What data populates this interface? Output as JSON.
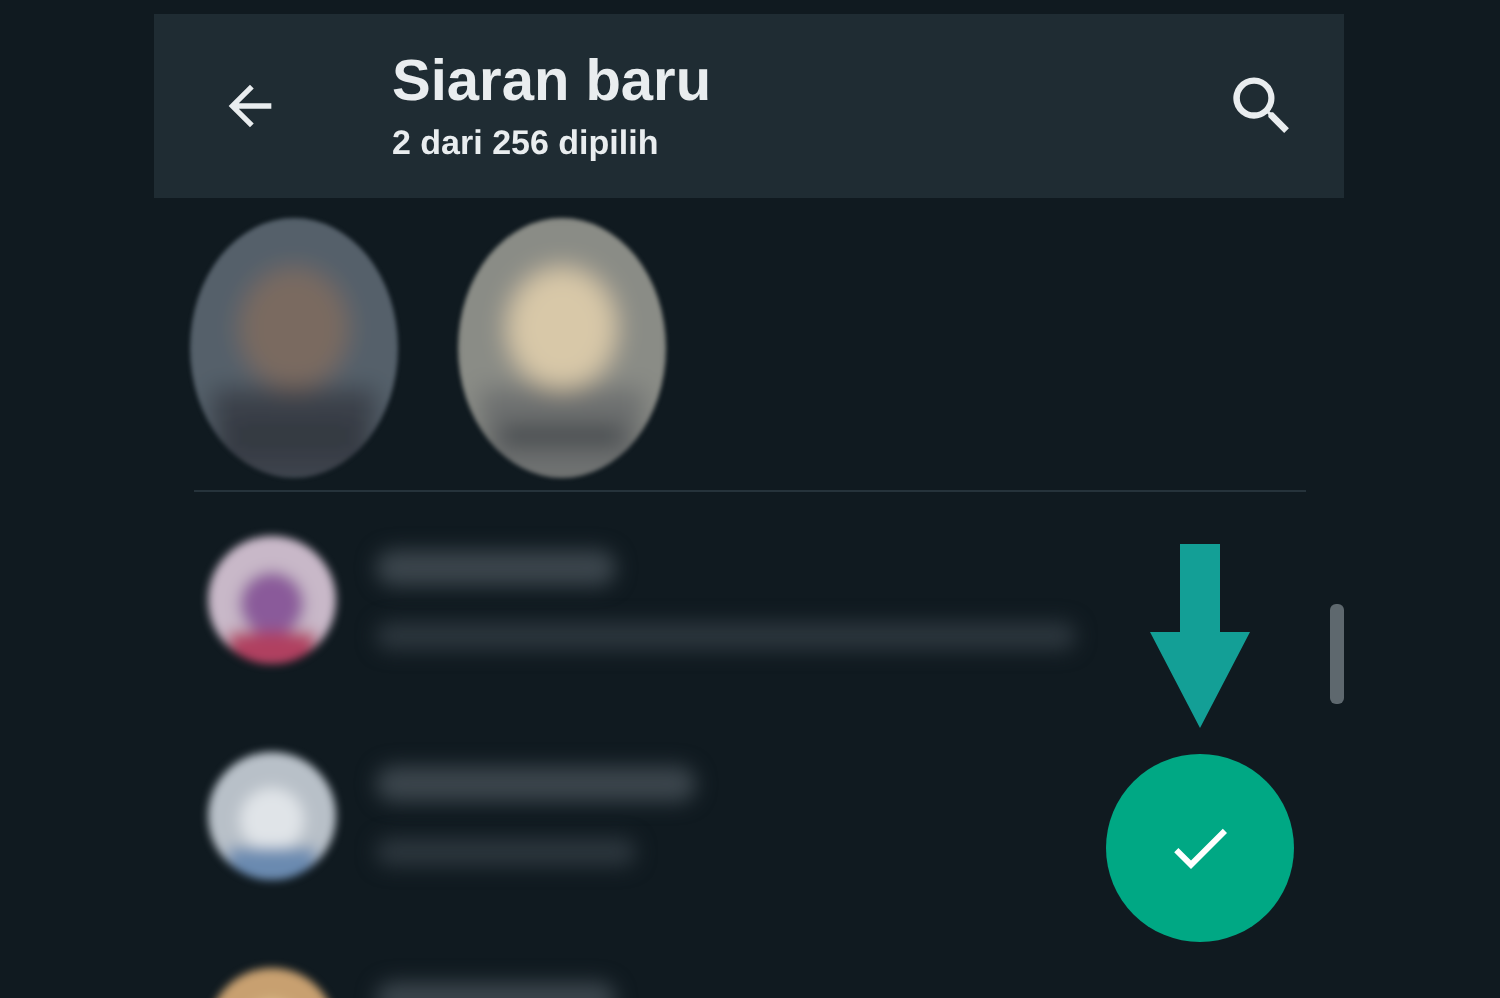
{
  "header": {
    "title": "Siaran baru",
    "subtitle": "2 dari 256 dipilih"
  }
}
